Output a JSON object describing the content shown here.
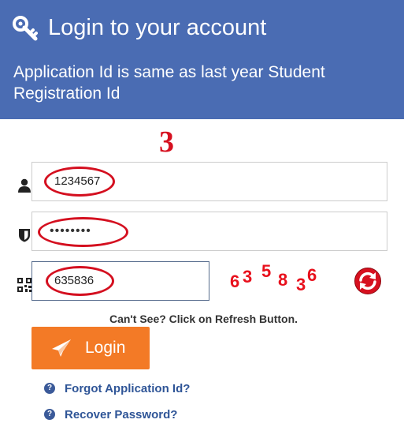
{
  "header": {
    "icon": "key-icon",
    "title": "Login to your account",
    "subtitle": "Application Id is same as last year Student Registration Id"
  },
  "annotation": {
    "step_number": "3"
  },
  "form": {
    "application_id": {
      "icon": "user-icon",
      "value": "1234567"
    },
    "password": {
      "icon": "shield-icon",
      "value": "••••••••"
    },
    "captcha_input": {
      "icon": "qr-code-icon",
      "value": "635836"
    },
    "captcha_image": {
      "chars": [
        "6",
        "3",
        "5",
        "8",
        "3",
        "6"
      ]
    },
    "refresh_icon": "refresh-icon",
    "hint": "Can't See? Click on Refresh Button.",
    "login_button": {
      "icon": "send-icon",
      "label": "Login"
    }
  },
  "links": {
    "forgot_id": {
      "icon": "question-circle-icon",
      "label": "Forgot Application Id?"
    },
    "recover_password": {
      "icon": "question-circle-icon",
      "label": "Recover Password?"
    }
  },
  "colors": {
    "header_bg": "#4a6cb3",
    "accent_orange": "#f37a26",
    "annotation_red": "#d40f1f",
    "link_blue": "#2f5597"
  }
}
